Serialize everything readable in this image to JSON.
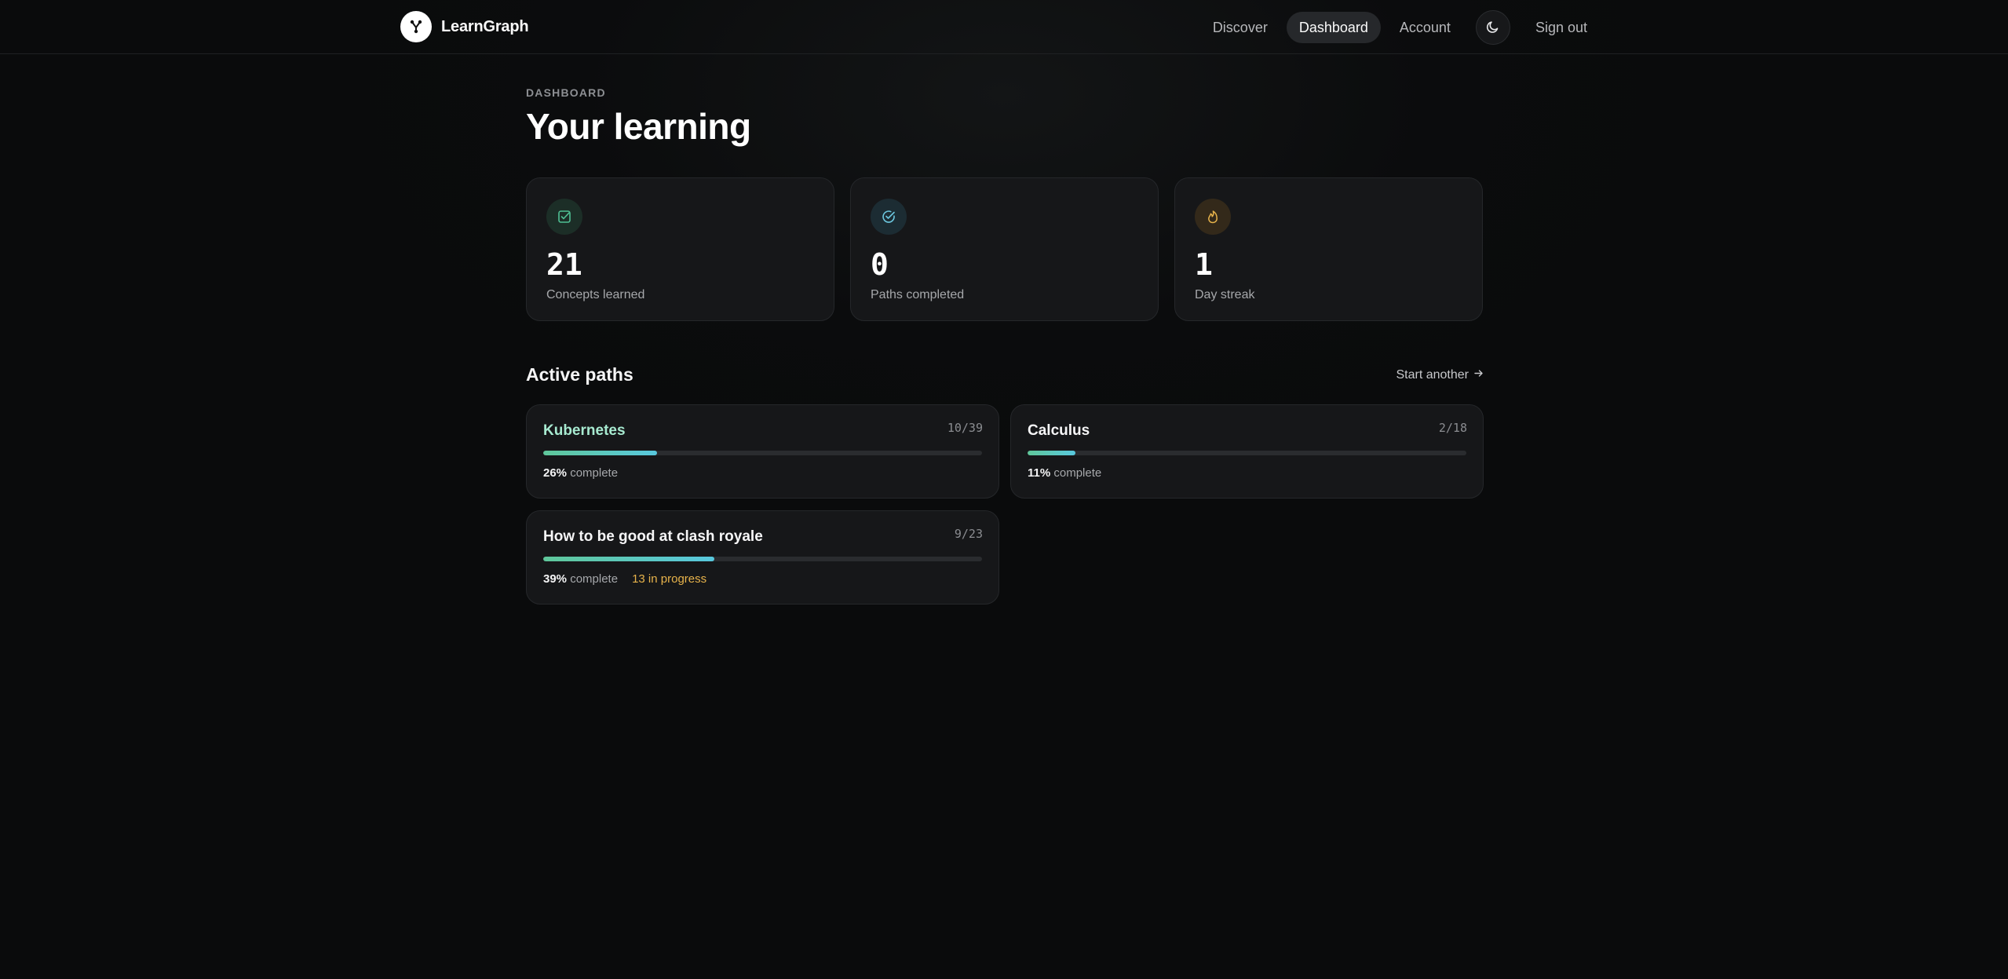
{
  "brand": {
    "name": "LearnGraph",
    "logo_icon": "branch-fork-icon"
  },
  "nav": {
    "items": [
      {
        "label": "Discover",
        "active": false
      },
      {
        "label": "Dashboard",
        "active": true
      },
      {
        "label": "Account",
        "active": false
      }
    ],
    "theme_icon": "moon-icon",
    "signout": "Sign out"
  },
  "page": {
    "eyebrow": "DASHBOARD",
    "title": "Your learning"
  },
  "stats": [
    {
      "value": "21",
      "label": "Concepts learned",
      "icon": "check-square-icon",
      "color": "#4fbf93",
      "bg": "#1c2e27"
    },
    {
      "value": "0",
      "label": "Paths completed",
      "icon": "check-circle-icon",
      "color": "#6cc7df",
      "bg": "#1c2c33"
    },
    {
      "value": "1",
      "label": "Day streak",
      "icon": "flame-icon",
      "color": "#e7b34b",
      "bg": "#33291a"
    }
  ],
  "active_paths": {
    "title": "Active paths",
    "start_another": "Start another",
    "items": [
      {
        "name": "Kubernetes",
        "count": "10/39",
        "progress": 0.26,
        "pct": "26%",
        "complete_word": "complete",
        "in_progress": ""
      },
      {
        "name": "Calculus",
        "count": "2/18",
        "progress": 0.11,
        "pct": "11%",
        "complete_word": "complete",
        "in_progress": ""
      },
      {
        "name": "How to be good at clash royale",
        "count": "9/23",
        "progress": 0.39,
        "pct": "39%",
        "complete_word": "complete",
        "in_progress": "13 in progress"
      }
    ]
  },
  "colors": {
    "accent_green": "#5fc79a",
    "accent_cyan": "#58c8de",
    "amber": "#e7b34b",
    "background": "#0a0b0c"
  }
}
